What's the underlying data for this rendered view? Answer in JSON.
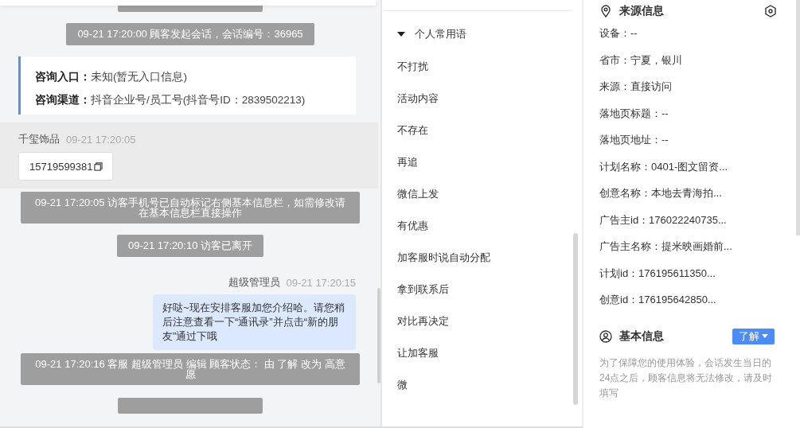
{
  "chat": {
    "messages": [
      {
        "kind": "system",
        "text": "09-21 17:20:00 顾客发起会话，会话编号：36965",
        "wide": false
      },
      {
        "kind": "source_card",
        "fields": [
          {
            "label": "咨询入口：",
            "value": "未知(暂无入口信息)"
          },
          {
            "label": "咨询渠道：",
            "value": "抖音企业号/员工号(抖音号ID：2839502213)"
          }
        ]
      },
      {
        "kind": "visitor",
        "sender": "千玺饰品",
        "time": "09-21 17:20:05",
        "text": "15719599381"
      },
      {
        "kind": "system",
        "text": "09-21 17:20:05 访客手机号已自动标记右侧基本信息栏，如需修改请在基本信息栏直接操作",
        "wide": true
      },
      {
        "kind": "system",
        "text": "09-21 17:20:10 访客已离开",
        "wide": false
      },
      {
        "kind": "agent",
        "sender": "超级管理员",
        "time": "09-21 17:20:15",
        "text": "好哒~现在安排客服加您介绍哈。请您稍后注意查看一下“通讯录”并点击“新的朋友”通过下哦"
      },
      {
        "kind": "system",
        "text": "09-21 17:20:16 客服 超级管理员 编辑 顾客状态： 由 了解 改为 高意愿",
        "wide": true
      }
    ]
  },
  "quick_phrases": {
    "group": {
      "title": "个人常用语",
      "expanded": true
    },
    "items": [
      "不打扰",
      "活动内容",
      "不存在",
      "再追",
      "微信上发",
      "有优惠",
      "加客服时说自动分配",
      "拿到联系后",
      "对比再决定",
      "让加客服",
      "微"
    ]
  },
  "source_info": {
    "title": "来源信息",
    "fields": [
      "设备：--",
      "省市：宁夏，银川",
      "来源：直接访问",
      "落地页标题：--",
      "落地页地址：--",
      "计划名称：0401-图文留资...",
      "创意名称：本地去青海拍...",
      "广告主id：176022240735...",
      "广告主名称：提米映画婚前...",
      "计划id：176195611350...",
      "创意id：176195642850..."
    ]
  },
  "basic_info": {
    "title": "基本信息",
    "status": "了解",
    "note": "为了保障您的使用体验，会话发生当日的24点之后，顾客信息将无法修改，请及时填写"
  }
}
